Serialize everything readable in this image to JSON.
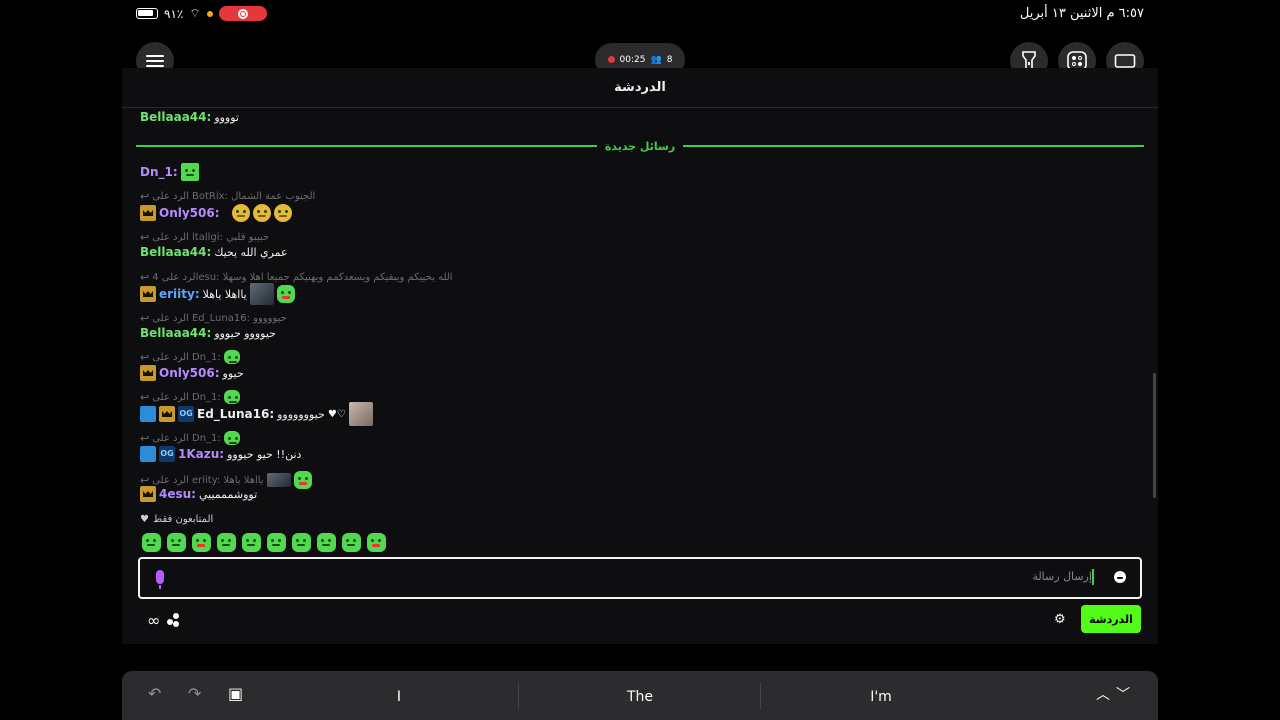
{
  "status_bar": {
    "battery_percent": "٩١٪",
    "time_date": "٦:٥٧ م   الاثنين ١٣ أبريل"
  },
  "stream": {
    "timer": "00:25",
    "viewers": "8"
  },
  "chat": {
    "title": "الدردشة",
    "new_messages_label": "رسائل جديدة",
    "top_message": {
      "user": "Bellaaa44:",
      "text": "توووو"
    },
    "messages": [
      {
        "user": "Dn_1:",
        "text": ""
      },
      {
        "reply": "الرد على BotRix: الجنوب عمة الشمال",
        "user": "Only506:",
        "text": ""
      },
      {
        "reply": "الرد على ltallgi: حبيبو قلبي",
        "user": "Bellaaa44:",
        "text": "عمري الله يحيك"
      },
      {
        "reply": "الرد على 4esu: الله يحييكم ويبقيكم ويسعدكمم ويهنيكم جميعا اهلا وسهلا",
        "user": "eriity:",
        "text": "يااهلا ياهلا"
      },
      {
        "reply": "الرد على Ed_Luna16: حيووووو",
        "user": "Bellaaa44:",
        "text": "حيوووو حيووو"
      },
      {
        "reply": "الرد على Dn_1:",
        "user": "Only506:",
        "text": "حيوو"
      },
      {
        "reply": "الرد على Dn_1:",
        "user": "Ed_Luna16:",
        "text": "حيووووووو"
      },
      {
        "reply": "الرد على Dn_1:",
        "user": "1Kazu:",
        "text": "دنن!! حيو حيووو"
      },
      {
        "reply": "الرد على eriity: يااهلا ياهلا",
        "user": "4esu:",
        "text": "تووشمممييي"
      }
    ],
    "followers_only": "المتابعون فقط",
    "input_placeholder": "إرسال رسالة",
    "chat_button": "الدردشة"
  },
  "keyboard": {
    "suggestions": [
      "I",
      "The",
      "I'm"
    ]
  },
  "colors": {
    "accent_green": "#53fc18",
    "new_msgs_green": "#3fd13f",
    "panel_bg": "#0e0e10"
  },
  "icons": [
    "hamburger-icon",
    "flashlight-icon",
    "gamepad-icon",
    "window-icon",
    "mic-icon",
    "smile-icon",
    "gear-icon",
    "infinity-icon",
    "undo-icon",
    "redo-icon",
    "clipboard-icon"
  ]
}
